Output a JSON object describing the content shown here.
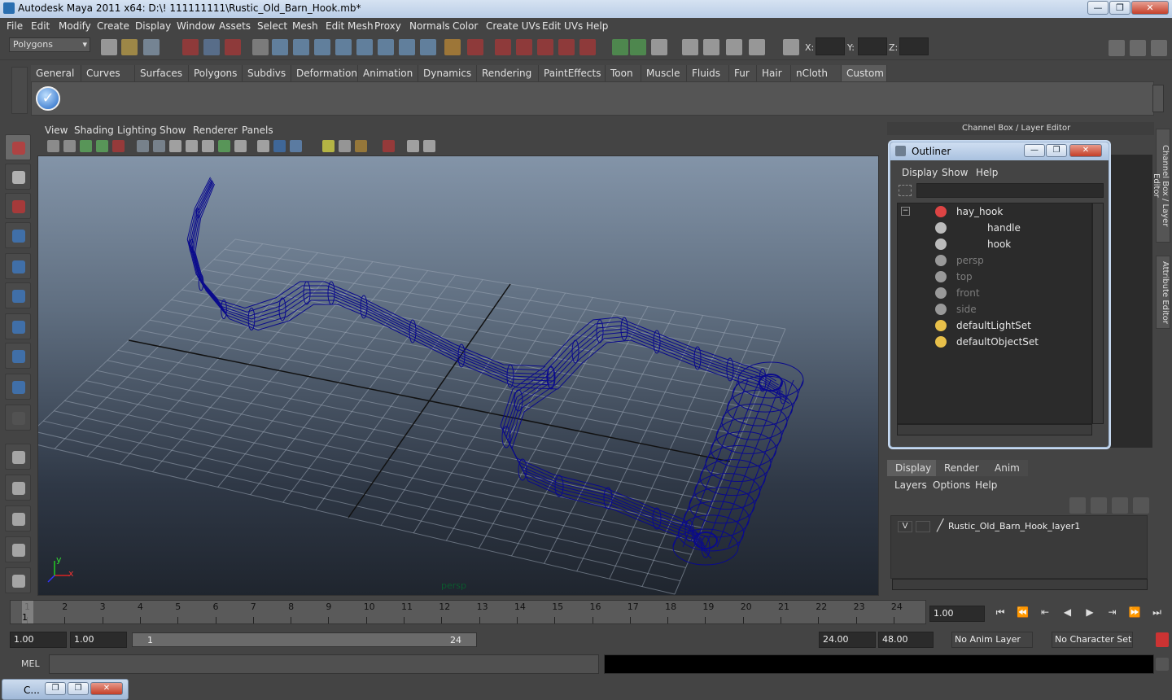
{
  "window": {
    "title": "Autodesk Maya 2011 x64: D:\\! 111111111\\Rustic_Old_Barn_Hook.mb*",
    "minimize_glyph": "—",
    "maximize_glyph": "❐",
    "close_glyph": "✕"
  },
  "menubar": [
    "File",
    "Edit",
    "Modify",
    "Create",
    "Display",
    "Window",
    "Assets",
    "Select",
    "Mesh",
    "Edit Mesh",
    "Proxy",
    "Normals",
    "Color",
    "Create UVs",
    "Edit UVs",
    "Help"
  ],
  "status_line": {
    "mode": "Polygons",
    "x_label": "X:",
    "y_label": "Y:",
    "z_label": "Z:"
  },
  "shelf": {
    "tabs": [
      "General",
      "Curves",
      "Surfaces",
      "Polygons",
      "Subdivs",
      "Deformation",
      "Animation",
      "Dynamics",
      "Rendering",
      "PaintEffects",
      "Toon",
      "Muscle",
      "Fluids",
      "Fur",
      "Hair",
      "nCloth",
      "Custom"
    ],
    "active_tab": "Custom",
    "check_glyph": "✓"
  },
  "viewport": {
    "menu": [
      "View",
      "Shading",
      "Lighting",
      "Show",
      "Renderer",
      "Panels"
    ],
    "camera_label": "persp",
    "axis_x": "x",
    "axis_y": "y",
    "wire_color": "#0a0a8c"
  },
  "channel_box": {
    "title": "Channel Box / Layer Editor"
  },
  "side_tabs": {
    "channel_box": "Channel Box / Layer Editor",
    "attribute_editor": "Attribute Editor"
  },
  "outliner": {
    "title": "Outliner",
    "menu": [
      "Display",
      "Show",
      "Help"
    ],
    "collapse_glyph": "−",
    "items": [
      {
        "label": "hay_hook",
        "dim": false
      },
      {
        "label": "handle",
        "dim": false
      },
      {
        "label": "hook",
        "dim": false
      },
      {
        "label": "persp",
        "dim": true
      },
      {
        "label": "top",
        "dim": true
      },
      {
        "label": "front",
        "dim": true
      },
      {
        "label": "side",
        "dim": true
      },
      {
        "label": "defaultLightSet",
        "dim": false
      },
      {
        "label": "defaultObjectSet",
        "dim": false
      }
    ]
  },
  "layer_editor": {
    "tabs": [
      "Display",
      "Render",
      "Anim"
    ],
    "active_tab": "Display",
    "menu": [
      "Layers",
      "Options",
      "Help"
    ],
    "layers": [
      {
        "visible": "V",
        "name": "Rustic_Old_Barn_Hook_layer1"
      }
    ]
  },
  "time_slider": {
    "ticks": [
      "1",
      "2",
      "3",
      "4",
      "5",
      "6",
      "7",
      "8",
      "9",
      "10",
      "11",
      "12",
      "13",
      "14",
      "15",
      "16",
      "17",
      "18",
      "19",
      "20",
      "21",
      "22",
      "23",
      "24"
    ],
    "current_frame_marker": "1",
    "current_time": "1.00"
  },
  "playback": {
    "buttons": [
      "⏮",
      "⏪",
      "⇤",
      "◀",
      "▶",
      "⇥",
      "⏩",
      "⏭"
    ]
  },
  "range_slider": {
    "start_time": "1.00",
    "playback_start": "1.00",
    "range_start_label": "1",
    "range_end_label": "24",
    "playback_end": "24.00",
    "end_time": "48.00",
    "anim_layer": "No Anim Layer",
    "character_set": "No Character Set"
  },
  "command_line": {
    "label": "MEL"
  },
  "taskbar": {
    "minimized_title": "C..."
  }
}
